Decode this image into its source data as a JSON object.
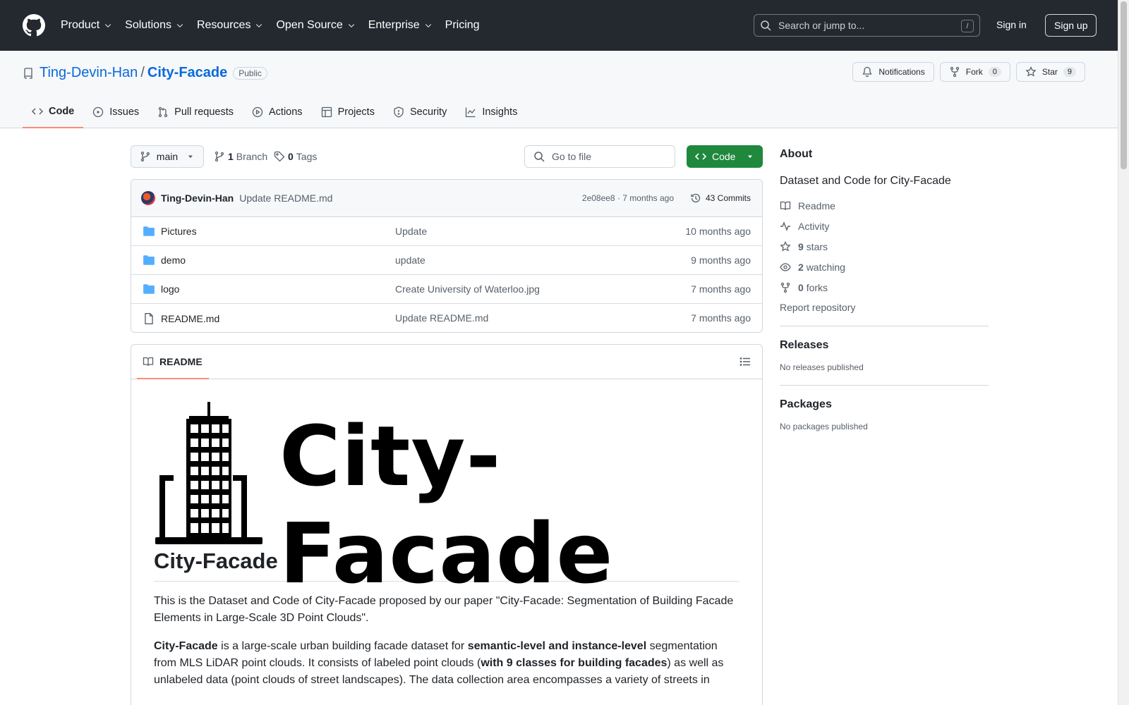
{
  "header": {
    "nav": [
      "Product",
      "Solutions",
      "Resources",
      "Open Source",
      "Enterprise",
      "Pricing"
    ],
    "search_placeholder": "Search or jump to...",
    "search_shortcut": "/",
    "sign_in": "Sign in",
    "sign_up": "Sign up"
  },
  "repo": {
    "owner": "Ting-Devin-Han",
    "separator": "/",
    "name": "City-Facade",
    "visibility": "Public",
    "notifications_label": "Notifications",
    "fork_label": "Fork",
    "fork_count": "0",
    "star_label": "Star",
    "star_count": "9"
  },
  "tabs": [
    {
      "label": "Code",
      "icon": "code-icon"
    },
    {
      "label": "Issues",
      "icon": "issue-icon"
    },
    {
      "label": "Pull requests",
      "icon": "pull-request-icon"
    },
    {
      "label": "Actions",
      "icon": "play-icon"
    },
    {
      "label": "Projects",
      "icon": "table-icon"
    },
    {
      "label": "Security",
      "icon": "shield-icon"
    },
    {
      "label": "Insights",
      "icon": "graph-icon"
    }
  ],
  "toolbar": {
    "branch": "main",
    "branch_count": "1",
    "branch_label": "Branch",
    "tag_count": "0",
    "tag_label": "Tags",
    "goto_placeholder": "Go to file",
    "code_label": "Code"
  },
  "commit": {
    "user": "Ting-Devin-Han",
    "message": "Update README.md",
    "hash_time": "2e08ee8 · 7 months ago",
    "count": "43 Commits"
  },
  "files": [
    {
      "name": "Pictures",
      "type": "folder",
      "message": "Update",
      "date": "10 months ago"
    },
    {
      "name": "demo",
      "type": "folder",
      "message": "update",
      "date": "9 months ago"
    },
    {
      "name": "logo",
      "type": "folder",
      "message": "Create University of Waterloo.jpg",
      "date": "7 months ago"
    },
    {
      "name": "README.md",
      "type": "file",
      "message": "Update README.md",
      "date": "7 months ago"
    }
  ],
  "readme": {
    "tab_label": "README",
    "logo_text": "City-Facade",
    "heading": "City-Facade",
    "para1": "This is the Dataset and Code of City-Facade proposed by our paper \"City-Facade: Segmentation of Building Facade Elements in Large-Scale 3D Point Clouds\".",
    "para2_b1": "City-Facade",
    "para2_t1": " is a large-scale urban building facade dataset for ",
    "para2_b2": "semantic-level and instance-level",
    "para2_t2": " segmentation from MLS LiDAR point clouds. It consists of labeled point clouds (",
    "para2_b3": "with 9 classes for building facades",
    "para2_t3": ") as well as unlabeled data (point clouds of street landscapes). The data collection area encompasses a variety of streets in"
  },
  "sidebar": {
    "about_title": "About",
    "description": "Dataset and Code for City-Facade",
    "readme": "Readme",
    "activity": "Activity",
    "stars_count": "9",
    "stars_label": "stars",
    "watching_count": "2",
    "watching_label": "watching",
    "forks_count": "0",
    "forks_label": "forks",
    "report": "Report repository",
    "releases_title": "Releases",
    "releases_empty": "No releases published",
    "packages_title": "Packages",
    "packages_empty": "No packages published"
  }
}
